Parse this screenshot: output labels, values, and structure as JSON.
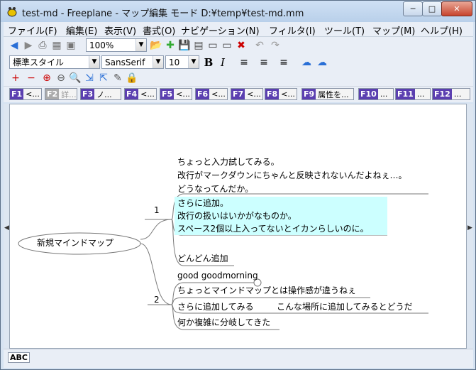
{
  "window": {
    "title": "test-md - Freeplane - マップ編集 モード D:¥temp¥test-md.mm",
    "controls": {
      "minimize": "─",
      "maximize": "□",
      "close": "✕"
    }
  },
  "menu": {
    "items": [
      "ファイル(F)",
      "編集(E)",
      "表示(V)",
      "書式(O)",
      "ナビゲーション(N)",
      "フィルタ(I)",
      "ツール(T)",
      "マップ(M)",
      "ヘルプ(H)"
    ]
  },
  "toolbar": {
    "zoom": "100%",
    "style": "標準スタイル",
    "font": "SansSerif",
    "font_size": "10",
    "bold": "B",
    "italic": "I"
  },
  "fkeys": [
    {
      "key": "F1",
      "label": "<..."
    },
    {
      "key": "F2",
      "label": "詳..."
    },
    {
      "key": "F3",
      "label": "ノ..."
    },
    {
      "key": "F4",
      "label": "<..."
    },
    {
      "key": "F5",
      "label": "<..."
    },
    {
      "key": "F6",
      "label": "<..."
    },
    {
      "key": "F7",
      "label": "<..."
    },
    {
      "key": "F8",
      "label": "<..."
    },
    {
      "key": "F9",
      "label": "属性を..."
    },
    {
      "key": "F10",
      "label": "..."
    },
    {
      "key": "F11",
      "label": "..."
    },
    {
      "key": "F12",
      "label": "..."
    }
  ],
  "mindmap": {
    "root": "新規マインドマップ",
    "branch1": {
      "label": "1",
      "note_lines": [
        "ちょっと入力試してみる。",
        "改行がマークダウンにちゃんと反映されないんだよねぇ…。",
        "どうなってんだか。"
      ],
      "highlight_lines": [
        "さらに追加。",
        "改行の扱いはいかがなものか。",
        "スペース2個以上入ってないとイカンらしいのに。"
      ],
      "child": "どんどん追加"
    },
    "branch2": {
      "label": "2",
      "folded_node": "good goodmorning",
      "children": [
        "ちょっとマインドマップとは操作感が違うねぇ",
        "さらに追加してみる",
        "何か複雑に分岐してきた"
      ],
      "grandchild": "こんな場所に追加してみるとどうだ"
    }
  },
  "status": {
    "spellcheck": "ABC"
  },
  "colors": {
    "highlight": "#ccffff",
    "fkey_badge": "#5b3fb0",
    "edge": "#7a7a7a"
  }
}
